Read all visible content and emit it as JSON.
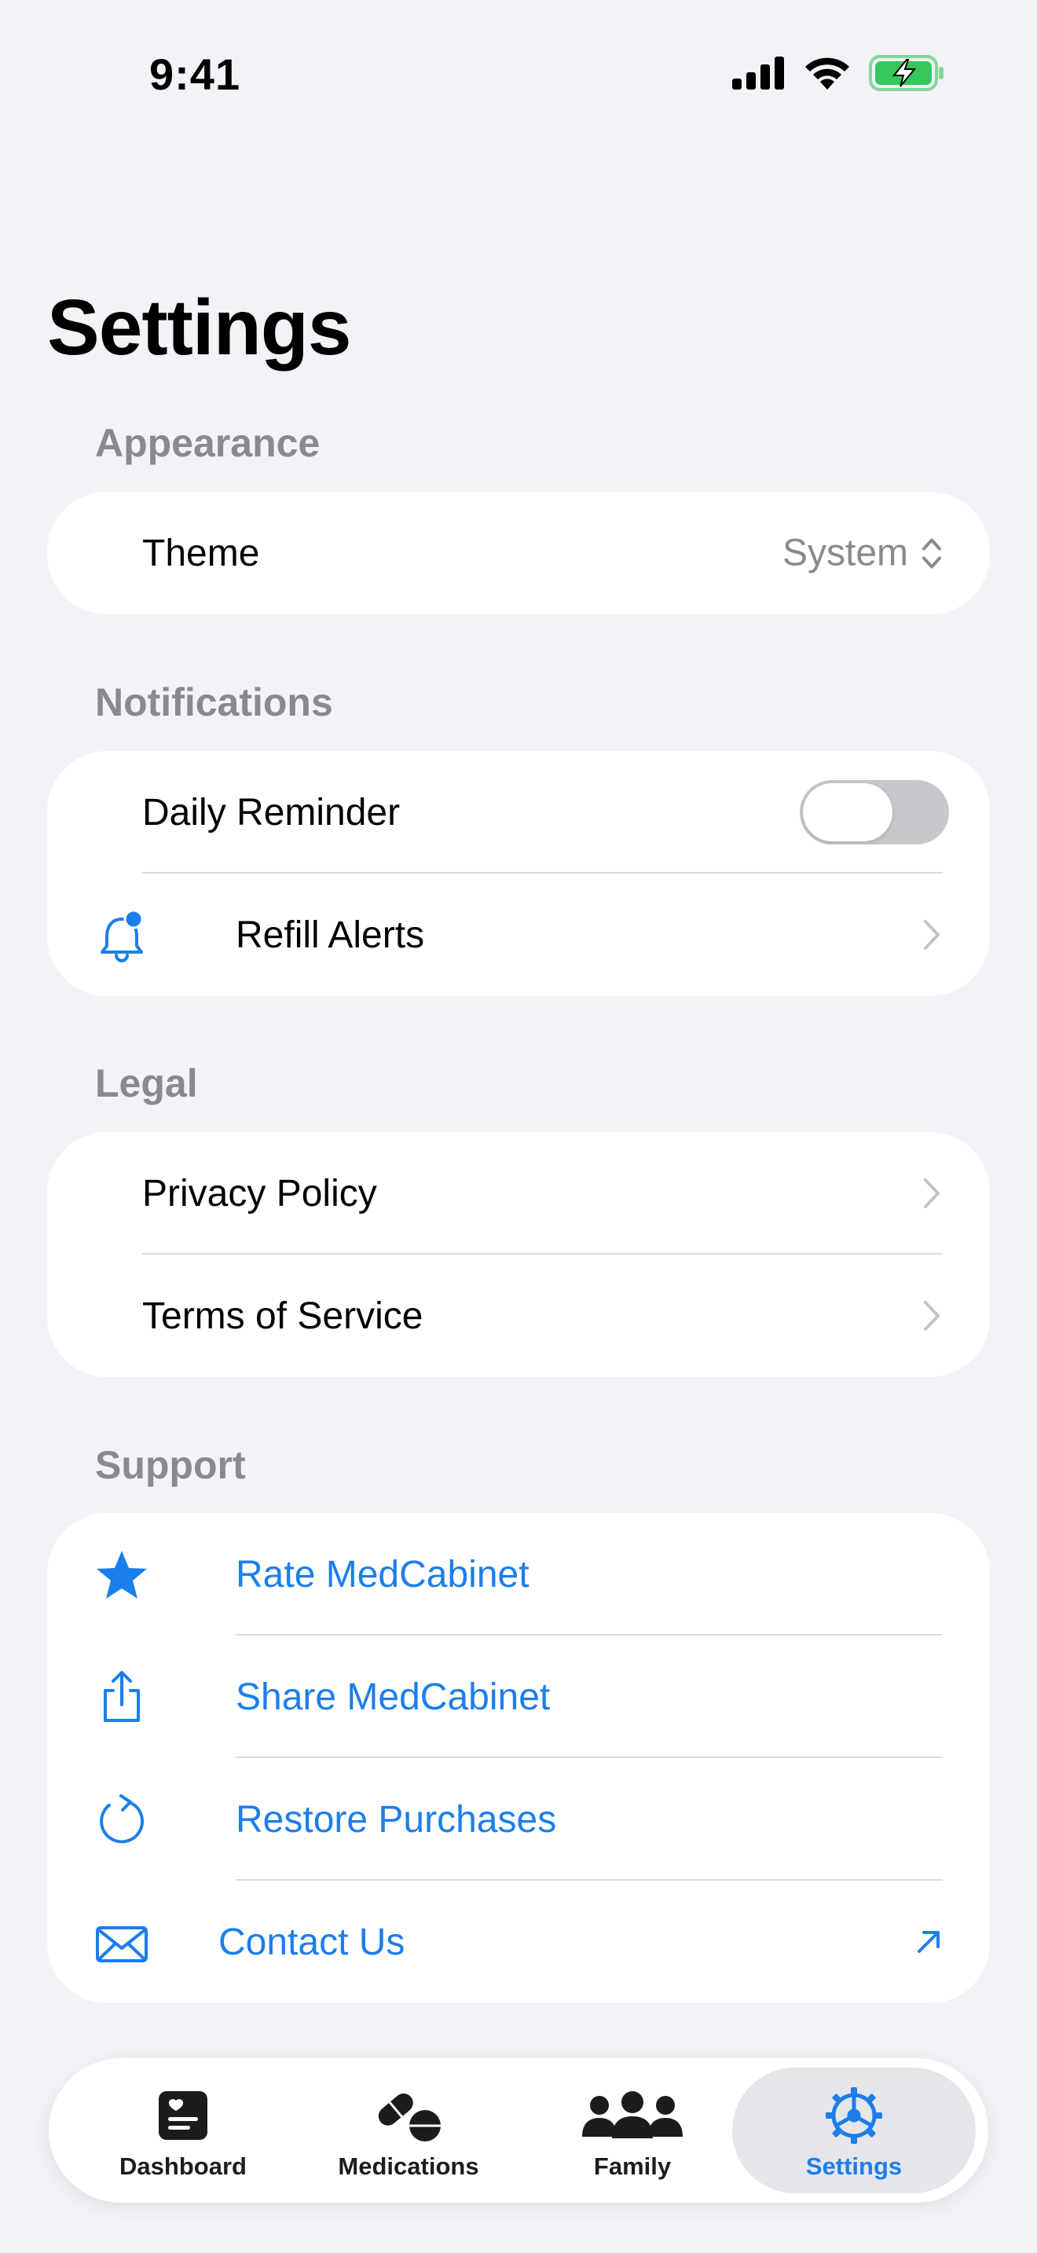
{
  "status_bar": {
    "time": "9:41"
  },
  "page_title": "Settings",
  "sections": {
    "appearance": {
      "header": "Appearance",
      "theme": {
        "label": "Theme",
        "value": "System"
      }
    },
    "notifications": {
      "header": "Notifications",
      "daily_reminder": {
        "label": "Daily Reminder",
        "enabled": false
      },
      "refill_alerts": {
        "label": "Refill Alerts",
        "icon": "bell-badge-icon"
      }
    },
    "legal": {
      "header": "Legal",
      "privacy_policy": "Privacy Policy",
      "terms_of_service": "Terms of Service"
    },
    "support": {
      "header": "Support",
      "rate": {
        "label": "Rate MedCabinet",
        "icon": "star-icon"
      },
      "share": {
        "label": "Share MedCabinet",
        "icon": "share-icon"
      },
      "restore": {
        "label": "Restore Purchases",
        "icon": "restore-icon"
      },
      "contact": {
        "label": "Contact Us",
        "icon": "envelope-icon"
      }
    }
  },
  "tab_bar": {
    "tabs": [
      {
        "label": "Dashboard",
        "icon": "dashboard-icon",
        "active": false
      },
      {
        "label": "Medications",
        "icon": "pills-icon",
        "active": false
      },
      {
        "label": "Family",
        "icon": "family-icon",
        "active": false
      },
      {
        "label": "Settings",
        "icon": "gear-icon",
        "active": true
      }
    ]
  },
  "colors": {
    "accent": "#1C7EEB",
    "background": "#F2F2F7",
    "secondary_text": "#8A8A8E",
    "battery_green": "#34C759"
  }
}
